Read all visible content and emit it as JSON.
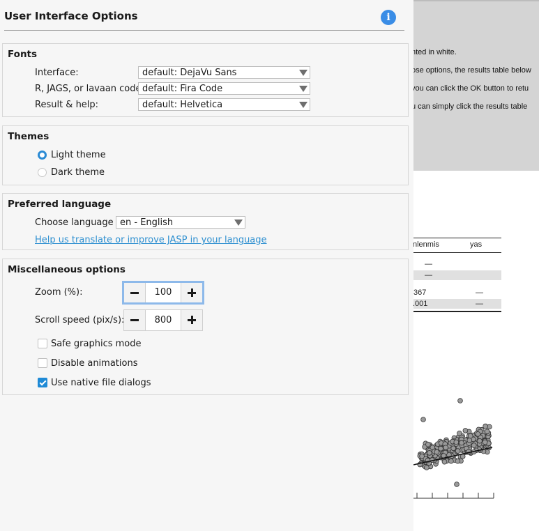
{
  "dialog": {
    "title": "User Interface Options",
    "info_icon": "i"
  },
  "fonts": {
    "title": "Fonts",
    "rows": [
      {
        "label": "Interface:",
        "value": "default: DejaVu Sans"
      },
      {
        "label": "R, JAGS, or lavaan code:",
        "value": "default: Fira Code"
      },
      {
        "label": "Result & help:",
        "value": "default: Helvetica"
      }
    ]
  },
  "themes": {
    "title": "Themes",
    "options": [
      {
        "label": "Light theme",
        "selected": true
      },
      {
        "label": "Dark theme",
        "selected": false
      }
    ]
  },
  "language": {
    "title": "Preferred language",
    "choose_label": "Choose language",
    "value": "en - English",
    "help_link": "Help us translate or improve JASP in your language"
  },
  "misc": {
    "title": "Miscellaneous options",
    "zoom_label": "Zoom (%):",
    "zoom_value": "100",
    "scroll_label": "Scroll speed (pix/s):",
    "scroll_value": "800",
    "checkboxes": [
      {
        "label": "Safe graphics mode",
        "checked": false
      },
      {
        "label": "Disable animations",
        "checked": false
      },
      {
        "label": "Use native file dialogs",
        "checked": true
      }
    ]
  },
  "background": {
    "notes": [
      "nted in white.",
      "ose options, the results table below",
      "you can click the OK button to retu",
      "u can simply click the results table"
    ],
    "table": {
      "headers": [
        "nlenmis",
        "yas"
      ],
      "rows": [
        [
          "—",
          ""
        ],
        [
          "—",
          ""
        ],
        [
          ".367",
          "—"
        ],
        [
          ".001",
          "—"
        ]
      ]
    }
  },
  "colors": {
    "accent": "#2a8ad4",
    "link": "#2d8fd0",
    "panel_bg": "#f6f6f6",
    "info_button": "#3a8de6"
  },
  "icons": {
    "info": "info-icon",
    "combo_arrow": "chevron-down-icon",
    "minus": "minus-icon",
    "plus": "plus-icon"
  }
}
